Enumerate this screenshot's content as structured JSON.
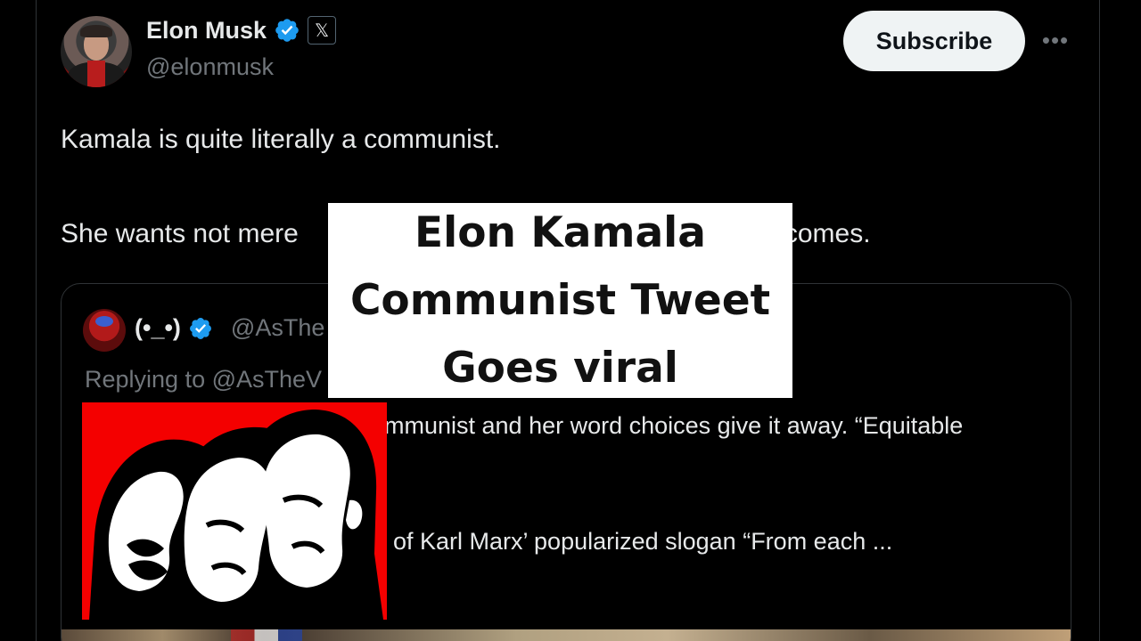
{
  "author": {
    "display_name": "Elon Musk",
    "handle": "@elonmusk",
    "badge_icon": "x-logo-icon",
    "verified_color": "#1d9bf0"
  },
  "actions": {
    "subscribe_label": "Subscribe",
    "more_label": "•••"
  },
  "tweet": {
    "line1": "Kamala is quite literally a communist.",
    "line2": "She wants not mere",
    "line2_tail": "utcomes."
  },
  "quote": {
    "display_name": "(•_•)",
    "handle": "@AsThe",
    "replying": "Replying to @AsTheV",
    "text1": "mmunist and her word choices give it away. “Equitable",
    "text2": "of Karl Marx’ popularized slogan “From each ..."
  },
  "overlay": {
    "line1": "Elon Kamala",
    "line2": "Communist Tweet",
    "line3": "Goes viral"
  },
  "colors": {
    "background": "#000000",
    "text": "#e7e9ea",
    "secondary": "#71767b",
    "border": "#2f3336",
    "image_red": "#f40000"
  }
}
